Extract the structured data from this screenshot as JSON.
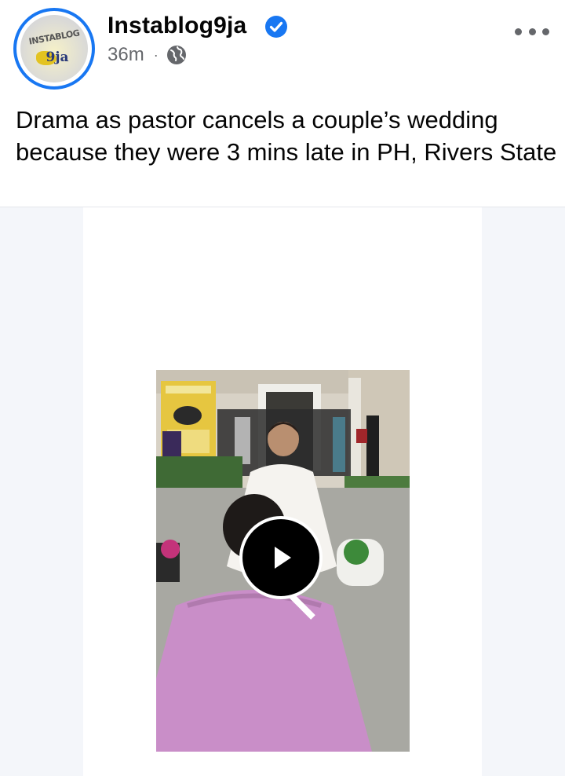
{
  "post": {
    "page_name": "Instablog9ja",
    "verified": true,
    "time": "36m",
    "separator": "·",
    "audience_icon": "globe-icon",
    "caption": "Drama as pastor cancels a couple’s wedding because they were 3 mins late in PH, Rivers State",
    "more_icon": "more-options-icon"
  },
  "avatar": {
    "logo_text": "INSTABLOG",
    "logo_sub": "9ja"
  },
  "media": {
    "type": "video",
    "play_icon": "play-icon"
  },
  "colors": {
    "accent": "#1877f2",
    "meta_text": "#65676b",
    "media_bg": "#f4f6fa",
    "dress": "#c98ec8"
  }
}
